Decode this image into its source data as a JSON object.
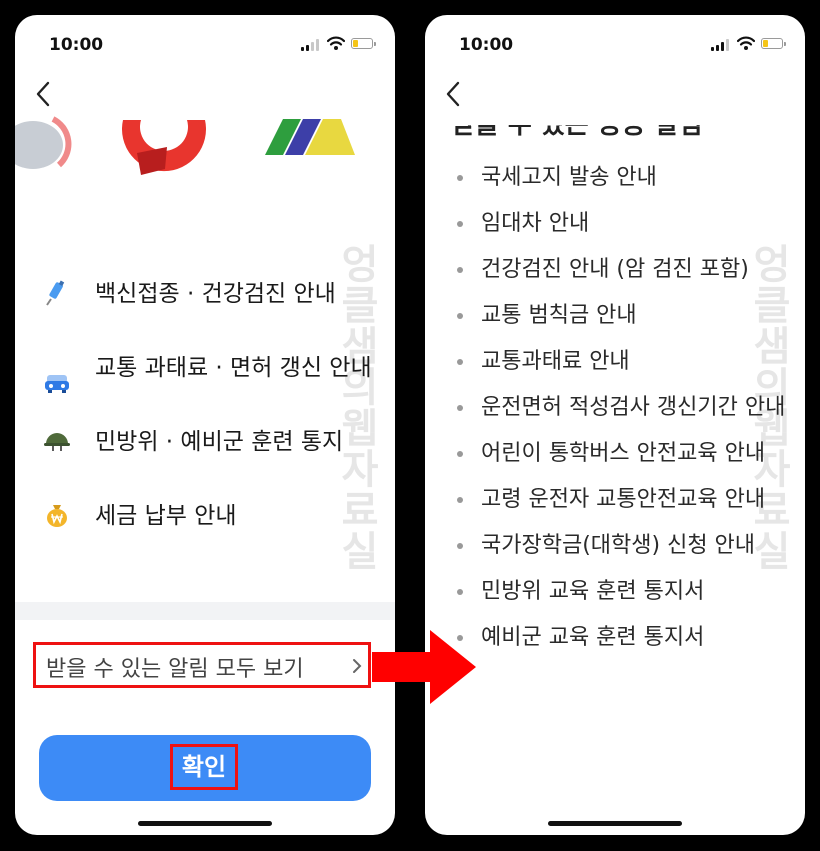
{
  "left_screen": {
    "time": "10:00",
    "items": [
      {
        "label": "백신접종 · 건강검진 안내",
        "icon": "syringe-icon"
      },
      {
        "label": "교통 과태료 · 면허 갱신 안내",
        "icon": "car-icon"
      },
      {
        "label": "민방위 · 예비군 훈련 통지",
        "icon": "helmet-icon"
      },
      {
        "label": "세금 납부 안내",
        "icon": "money-bag-icon"
      }
    ],
    "view_all": "받을 수 있는 알림 모두 보기",
    "confirm": "확인",
    "watermark": "엉클샘의웹자료실"
  },
  "right_screen": {
    "time": "10:00",
    "heading": "받을 수 있는 공공 알림",
    "items": [
      "국세고지 발송 안내",
      "임대차 안내",
      "건강검진 안내 (암 검진 포함)",
      "교통 범칙금 안내",
      "교통과태료 안내",
      "운전면허 적성검사 갱신기간 안내",
      "어린이 통학버스 안전교육 안내",
      "고령 운전자 교통안전교육 안내",
      "국가장학금(대학생) 신청 안내",
      "민방위 교육 훈련 통지서",
      "예비군 교육 훈련 통지서"
    ],
    "watermark": "엉클샘의웹자료실"
  },
  "colors": {
    "accent_blue": "#3d8bf6",
    "highlight_red": "#ee1111",
    "arrow_red": "#ff0000"
  }
}
